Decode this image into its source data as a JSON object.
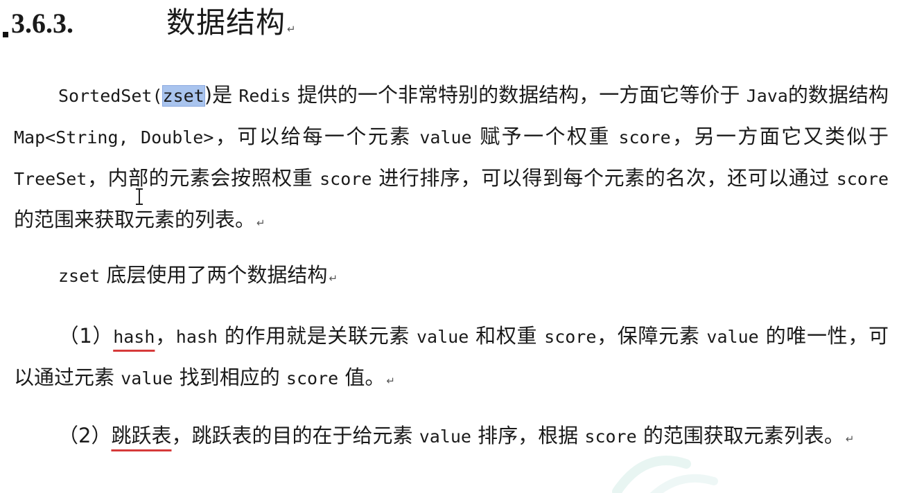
{
  "section": {
    "number": "3.6.3.",
    "title": "数据结构"
  },
  "paragraph_mark": "↵",
  "para1": {
    "t1": "SortedSet(",
    "t2": "zset",
    "t3": ")是 ",
    "t4": "Redis",
    "t5": " 提供的一个非常特别的数据结构，一方面它等价于 ",
    "t6": "Java",
    "t7": "的数据结构 ",
    "t8": "Map<String, Double>",
    "t9": "，可以给每一个元素 ",
    "t10": "value",
    "t11": " 赋予一个权重 ",
    "t12": "score",
    "t13": "，另一方面它又类似于 ",
    "t14": "TreeSet",
    "t15": "，内部的元素会按照权重 ",
    "t16": "score",
    "t17": " 进行排序，可以得到每个元素的名次，还可以通过 ",
    "t18": "score",
    "t19": " 的范围来获取元素的列表。"
  },
  "para2": {
    "t1": "zset",
    "t2": " 底层使用了两个数据结构"
  },
  "para3": {
    "t1": "（1）",
    "t2": "hash",
    "t3": "，",
    "t4": "hash",
    "t5": " 的作用就是关联元素 ",
    "t6": "value",
    "t7": " 和权重 ",
    "t8": "score",
    "t9": "，保障元素 ",
    "t10": "value",
    "t11": " 的唯一性，可以通过元素 ",
    "t12": "value",
    "t13": " 找到相应的 ",
    "t14": "score",
    "t15": " 值。"
  },
  "para4": {
    "t1": "（2）",
    "t2": "跳跃表",
    "t3": "，跳跃表的目的在于给元素 ",
    "t4": "value",
    "t5": " 排序，根据 ",
    "t6": "score",
    "t7": " 的范围获取元素列表。"
  },
  "colors": {
    "selection": "#a9c4ee",
    "underline": "#d63a3a",
    "text": "#1a1a1a"
  }
}
